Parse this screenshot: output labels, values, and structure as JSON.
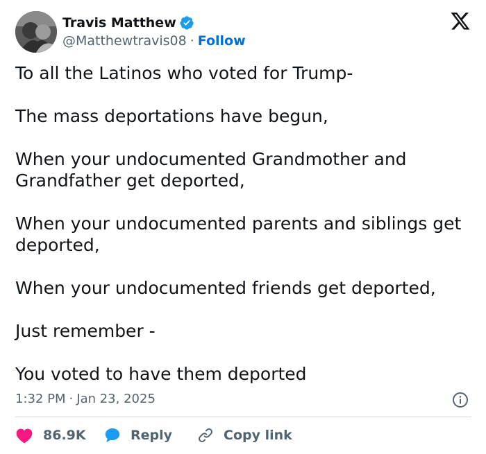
{
  "tweet": {
    "author": {
      "display_name": "Travis Matthew",
      "handle": "@Matthewtravis08",
      "separator": "·",
      "follow_label": "Follow",
      "verified": true
    },
    "platform_icon": "x-logo-icon",
    "body_paragraphs": [
      "To all the Latinos who voted for Trump-",
      "The mass deportations have begun,",
      "When your undocumented Grandmother and Grandfather get deported,",
      "When your undocumented parents and siblings get deported,",
      "When your undocumented friends get deported,",
      "Just remember -",
      "You voted to have them deported"
    ],
    "time": "1:32 PM",
    "date_separator": "·",
    "date": "Jan 23, 2025",
    "actions": {
      "like_count": "86.9K",
      "reply_label": "Reply",
      "copy_link_label": "Copy link"
    },
    "colors": {
      "text": "#0f1419",
      "secondary": "#536471",
      "link": "#006fd6",
      "like": "#f91880",
      "reply": "#1d9bf0",
      "divider": "#cfd9de"
    }
  }
}
